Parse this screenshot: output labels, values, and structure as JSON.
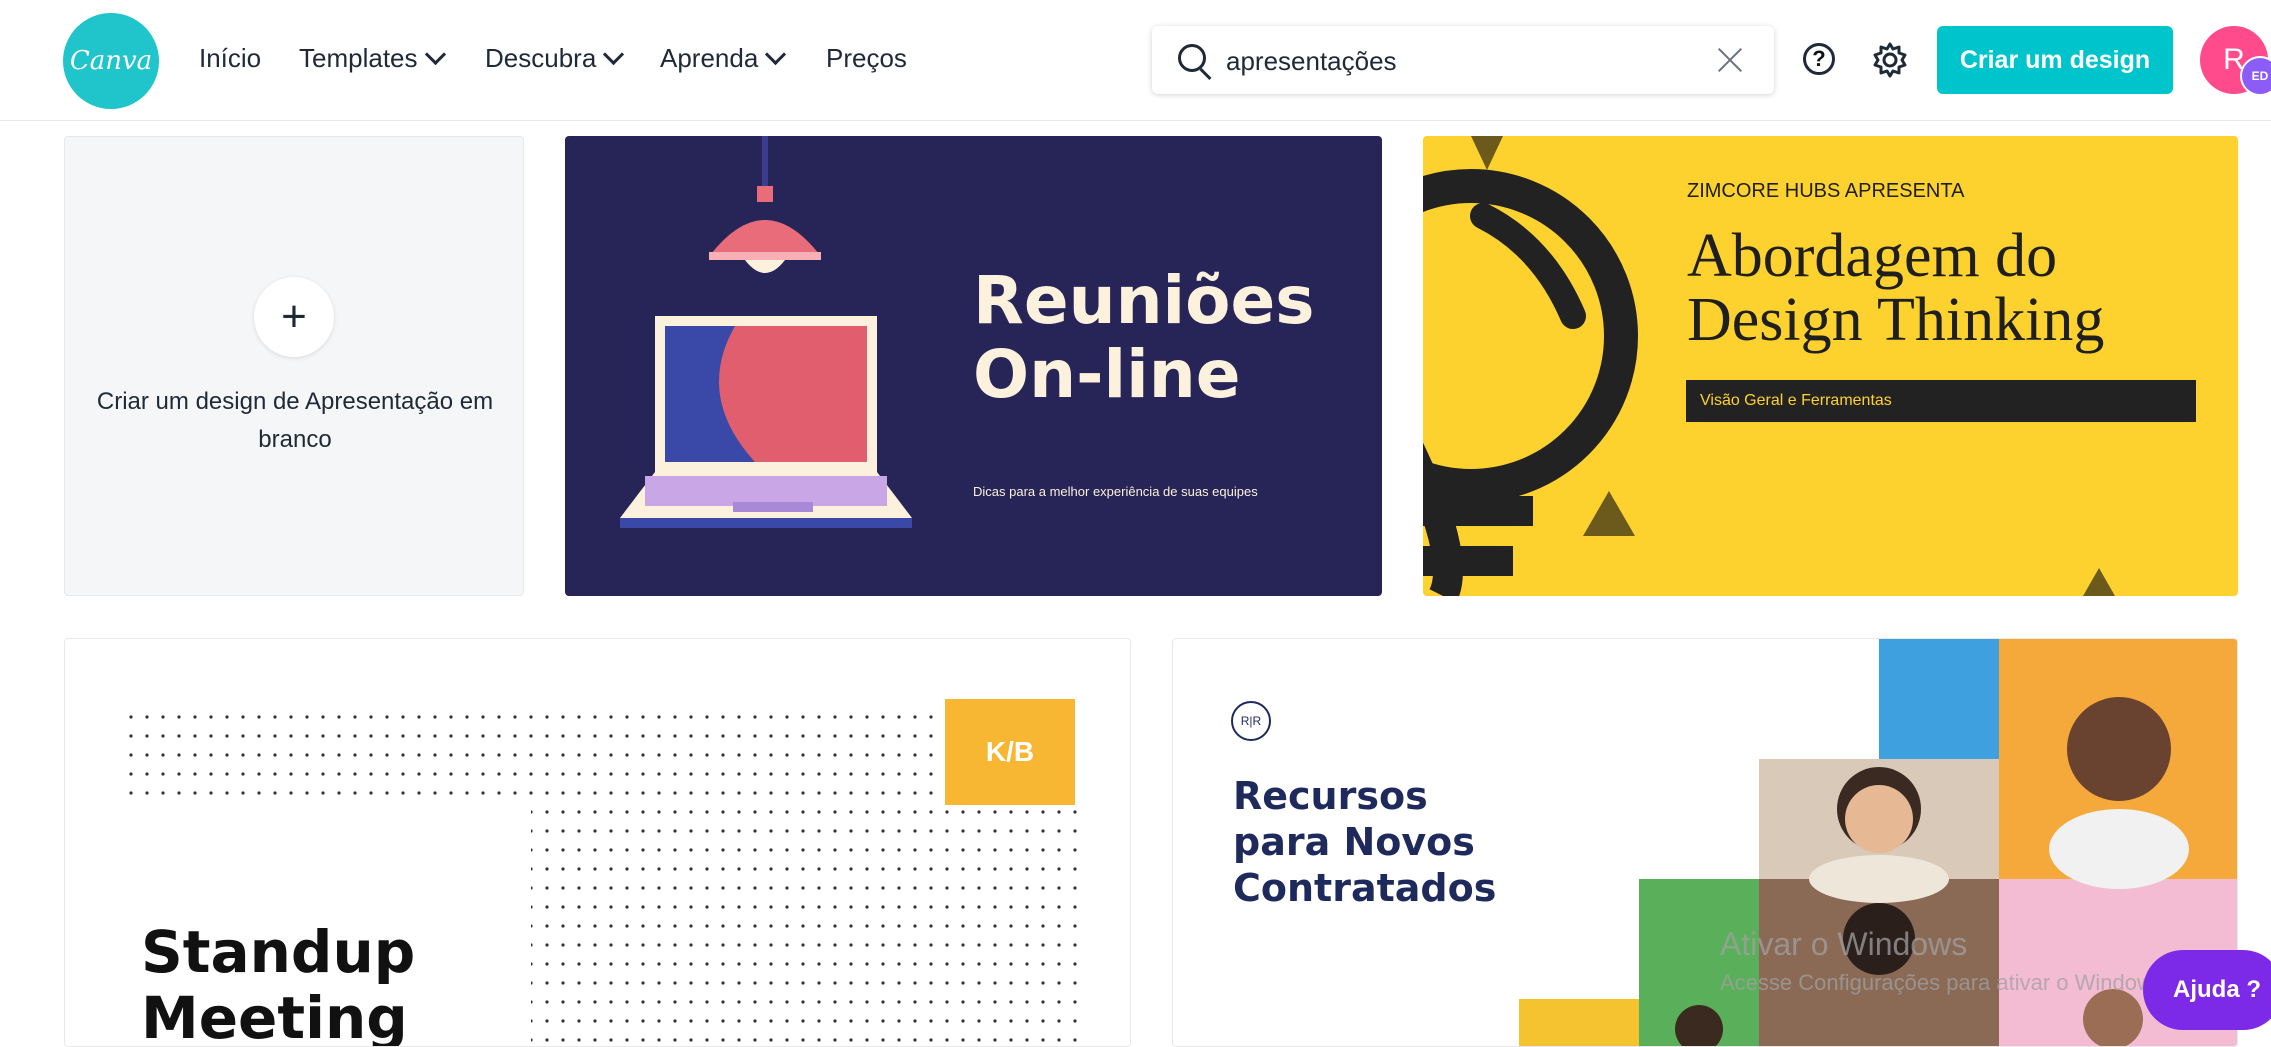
{
  "nav": {
    "logo": "Canva",
    "items": [
      {
        "label": "Início"
      },
      {
        "label": "Templates"
      },
      {
        "label": "Descubra"
      },
      {
        "label": "Aprenda"
      },
      {
        "label": "Preços"
      }
    ]
  },
  "search": {
    "value": "apresentações"
  },
  "header": {
    "help_icon": "?",
    "create_button": "Criar um design",
    "avatar_letter": "R",
    "avatar_badge": "ED",
    "accent": "#00c4cc"
  },
  "blank_card": {
    "plus": "+",
    "label": "Criar um design de Apresentação em branco"
  },
  "templates": {
    "reunioes": {
      "title_line1": "Reuniões",
      "title_line2": "On-line",
      "subtitle": "Dicas para a melhor experiência de suas equipes"
    },
    "design_thinking": {
      "eyebrow": "ZIMCORE HUBS APRESENTA",
      "title_line1": "Abordagem do",
      "title_line2": "Design Thinking",
      "bar_text": "Visão Geral e Ferramentas"
    },
    "standup": {
      "badge": "K/B",
      "title_line1": "Standup",
      "title_line2": "Meeting"
    },
    "recursos": {
      "logo": "R|R",
      "title_line1": "Recursos",
      "title_line2": "para Novos",
      "title_line3": "Contratados"
    }
  },
  "overlay": {
    "windows_line1": "Ativar o Windows",
    "windows_line2": "Acesse Configurações para ativar o Windows.",
    "help_button": "Ajuda ?"
  }
}
